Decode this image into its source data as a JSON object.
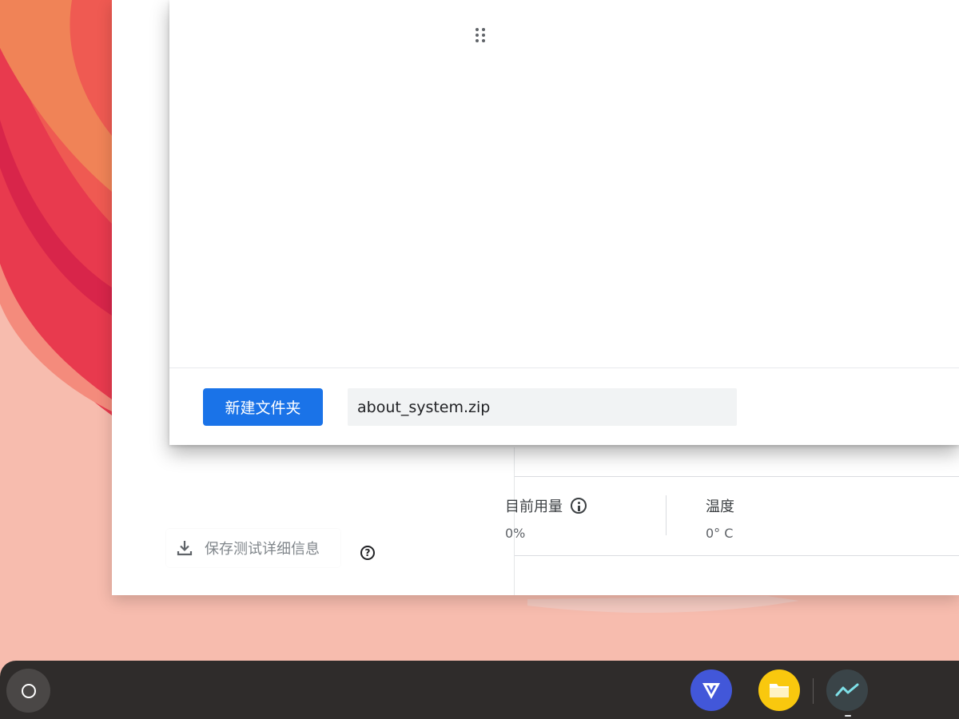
{
  "dialog": {
    "new_folder_label": "新建文件夹",
    "filename_value": "about_system.zip"
  },
  "diagnostics": {
    "usage_label": "目前用量",
    "usage_value": "0%",
    "temperature_label": "温度",
    "temperature_value": "0° C",
    "save_details_label": "保存测试详细信息"
  },
  "shelf": {
    "apps": [
      "launcher-icon",
      "v-app-icon",
      "files-icon",
      "diagnostics-icon"
    ]
  },
  "colors": {
    "accent": "#1a73e8",
    "wallpaper": "#f7bcae",
    "shelf": "#2f2c2b"
  }
}
